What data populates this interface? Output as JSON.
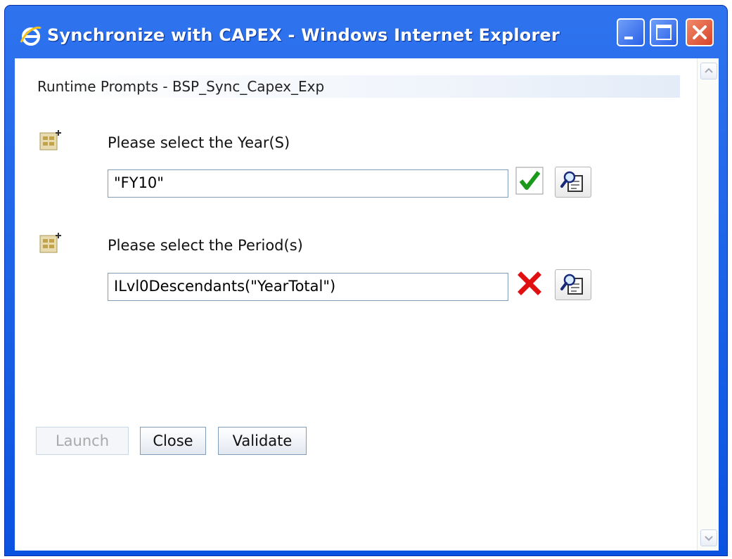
{
  "window": {
    "title": "Synchronize with CAPEX - Windows Internet Explorer",
    "icon": "ie-logo-icon",
    "controls": [
      "minimize-icon",
      "maximize-icon",
      "close-icon"
    ]
  },
  "prompts": {
    "header": "Runtime Prompts - BSP_Sync_Capex_Exp",
    "rows": [
      {
        "label": "Please select the Year(S)",
        "value": "\"FY10\"",
        "status": "valid",
        "status_icon": "green-checkmark-icon",
        "status_color": "#1a9a1a",
        "picker_icon": "member-selector-icon",
        "row_icon": "variable-prompt-icon"
      },
      {
        "label": "Please select the Period(s)",
        "value": "ILvl0Descendants(\"YearTotal\")",
        "status": "invalid",
        "status_icon": "red-x-icon",
        "status_color": "#e01010",
        "picker_icon": "member-selector-icon",
        "row_icon": "variable-prompt-icon"
      }
    ]
  },
  "buttons": {
    "launch": "Launch",
    "close": "Close",
    "validate": "Validate",
    "launch_enabled": false
  },
  "colors": {
    "titlebar": "#0a52e0",
    "close_button": "#d8432a"
  }
}
